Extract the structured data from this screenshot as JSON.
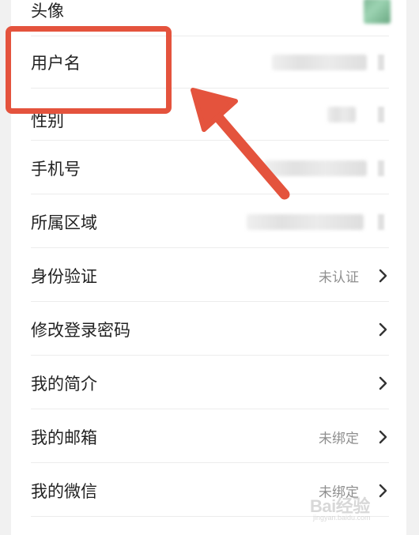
{
  "rows": {
    "avatar": {
      "label": "头像"
    },
    "username": {
      "label": "用户名"
    },
    "gender": {
      "label": "性别"
    },
    "phone": {
      "label": "手机号"
    },
    "region": {
      "label": "所属区域"
    },
    "verify": {
      "label": "身份验证",
      "status": "未认证"
    },
    "password": {
      "label": "修改登录密码"
    },
    "bio": {
      "label": "我的简介"
    },
    "email": {
      "label": "我的邮箱",
      "status": "未绑定"
    },
    "wechat": {
      "label": "我的微信",
      "status": "未绑定"
    }
  },
  "watermark": {
    "text": "Bai经验",
    "sub": "jingyan.baidu.com"
  },
  "colors": {
    "annotation": "#e4533d",
    "text": "#222222",
    "status": "#8f8f8f"
  },
  "icons": [
    "chevron-right-icon",
    "arrow-annotation"
  ]
}
